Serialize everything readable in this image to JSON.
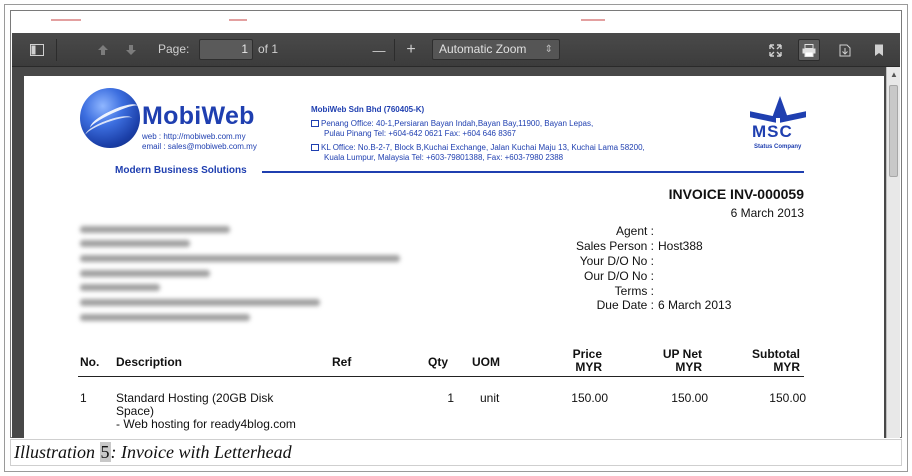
{
  "toolbar": {
    "page_label": "Page:",
    "page_value": "1",
    "page_total": "of 1",
    "zoom_minus": "—",
    "zoom_plus": "+",
    "zoom_selected": "Automatic Zoom"
  },
  "letterhead": {
    "brand": "MobiWeb",
    "web": "web   : http://mobiweb.com.my",
    "email": "email : sales@mobiweb.com.my",
    "tagline": "Modern Business Solutions",
    "company": "MobiWeb Sdn Bhd (760405-K)",
    "penang_line1": "Penang Office: 40-1,Persiaran Bayan Indah,Bayan Bay,11900, Bayan Lepas,",
    "penang_line2": "Pulau Pinang Tel: +604-642 0621 Fax: +604 646 8367",
    "kl_line1": "KL Office: No.B-2-7, Block B,Kuchai Exchange, Jalan Kuchai Maju 13, Kuchai Lama 58200,",
    "kl_line2": "Kuala Lumpur, Malaysia  Tel: +603-79801388, Fax: +603-7980 2388",
    "msc": "MSC",
    "msc_sub": "Status Company"
  },
  "invoice": {
    "title": "INVOICE INV-000059",
    "date": "6 March 2013",
    "meta": [
      {
        "label": "Agent :",
        "value": ""
      },
      {
        "label": "Sales Person :",
        "value": "Host388"
      },
      {
        "label": "Your D/O No :",
        "value": ""
      },
      {
        "label": "Our D/O No :",
        "value": ""
      },
      {
        "label": "Terms :",
        "value": ""
      },
      {
        "label": "Due Date :",
        "value": "6 March 2013"
      }
    ]
  },
  "table": {
    "headers": {
      "no": "No.",
      "description": "Description",
      "ref": "Ref",
      "qty": "Qty",
      "uom": "UOM",
      "price_1": "Price",
      "price_2": "MYR",
      "upnet_1": "UP Net",
      "upnet_2": "MYR",
      "subtotal_1": "Subtotal",
      "subtotal_2": "MYR"
    },
    "rows": [
      {
        "no": "1",
        "desc_1": "Standard Hosting (20GB Disk",
        "desc_2": "Space)",
        "desc_3": "- Web hosting for ready4blog.com",
        "qty": "1",
        "uom": "unit",
        "price": "150.00",
        "upnet": "150.00",
        "subtotal": "150.00"
      }
    ]
  },
  "caption": {
    "prefix": "Illustration ",
    "number": "5",
    "suffix": ": Invoice with Letterhead"
  }
}
